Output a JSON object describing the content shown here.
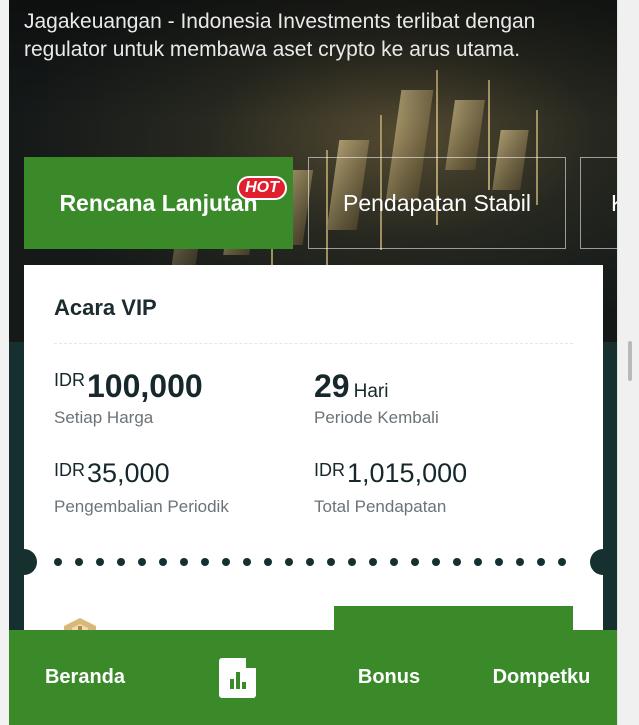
{
  "hero": {
    "headline": "Jagakeuangan - Indonesia Investments terlibat dengan regulator untuk membawa aset crypto ke arus utama."
  },
  "tabs": [
    {
      "label": "Rencana Lanjutan",
      "active": true
    },
    {
      "label": "Pendapatan Stabil",
      "active": false
    },
    {
      "label": "K",
      "active": false
    }
  ],
  "hot_badge": "HOT",
  "card": {
    "title": "Acara VIP",
    "price": {
      "currency": "IDR",
      "value": "100,000",
      "label": "Setiap Harga"
    },
    "period": {
      "value": "29",
      "unit": "Hari",
      "label": "Periode Kembali"
    },
    "periodic_return": {
      "currency": "IDR",
      "value": "35,000",
      "label": "Pengembalian Periodik"
    },
    "total_income": {
      "currency": "IDR",
      "value": "1,015,000",
      "label": "Total Pendapatan"
    }
  },
  "bottom_nav": {
    "beranda": "Beranda",
    "bonus": "Bonus",
    "dompetku": "Dompetku",
    "chart_icon": "chart-doc-icon"
  },
  "colors": {
    "accent_green": "#3a8a2a",
    "hot_red": "#e0202c",
    "dark_teal": "#15302f"
  }
}
